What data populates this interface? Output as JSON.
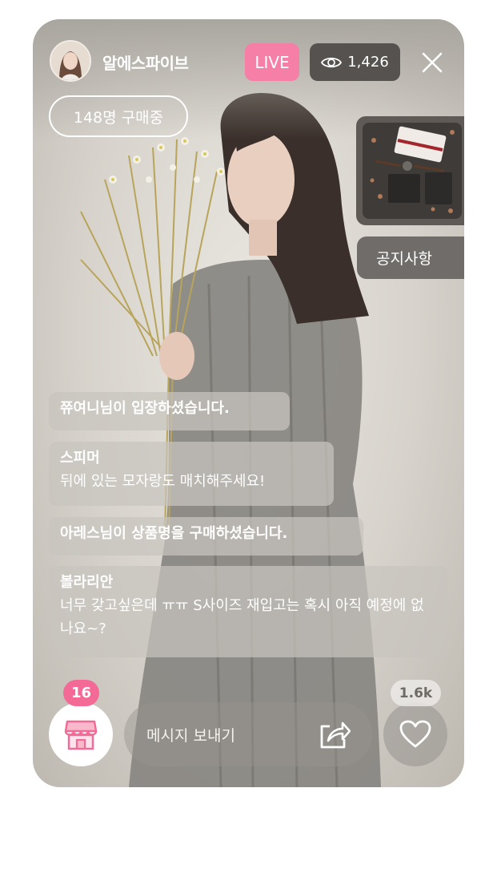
{
  "header": {
    "shop_name": "알에스파이브",
    "live_label": "LIVE",
    "viewer_count": "1,426"
  },
  "buying_label": "148명 구매중",
  "notice_label": "공지사항",
  "chat": [
    {
      "type": "system",
      "text": "쮸여니님이 입장하셨습니다."
    },
    {
      "type": "message",
      "user": "스피머",
      "text": "뒤에 있는 모자랑도 매치해주세요!"
    },
    {
      "type": "system",
      "text": "아레스님이 상품명을 구매하셨습니다."
    },
    {
      "type": "message",
      "user": "볼라리안",
      "text": "너무 갖고싶은데 ㅠㅠ S사이즈 재입고는 혹시 아직 예정에 없나요~?"
    }
  ],
  "bottom": {
    "cart_count": "16",
    "message_placeholder": "메시지 보내기",
    "like_count": "1.6k"
  },
  "colors": {
    "accent_pink": "#f36a96",
    "live_pink": "#f57fa6"
  },
  "icons": [
    "eye-icon",
    "close-icon",
    "store-icon",
    "share-icon",
    "heart-icon"
  ]
}
